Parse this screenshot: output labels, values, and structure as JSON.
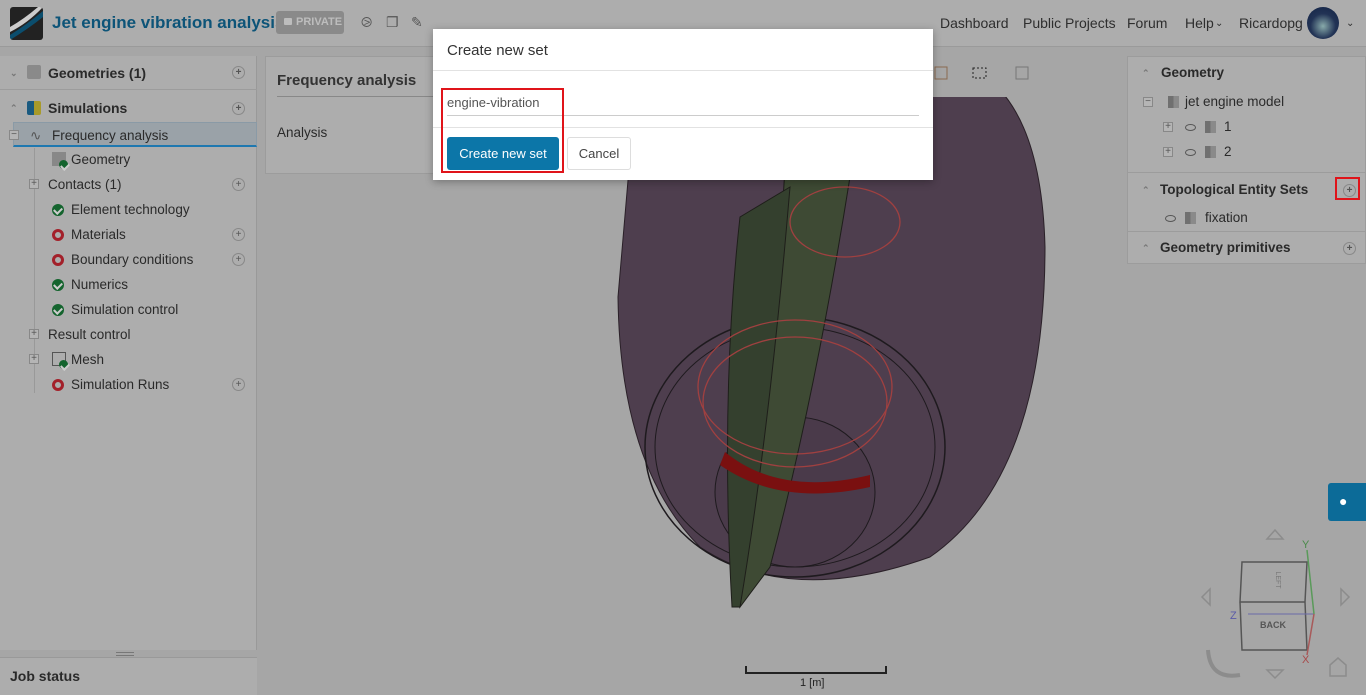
{
  "header": {
    "project_title": "Jet engine vibration analysis",
    "private_badge": "PRIVATE",
    "nav": [
      "Dashboard",
      "Public Projects",
      "Forum",
      "Help",
      "Ricardopg"
    ]
  },
  "left_tree": {
    "geometries": "Geometries (1)",
    "simulations": "Simulations",
    "simulation": "Frequency analysis",
    "items": [
      "Geometry",
      "Contacts (1)",
      "Element technology",
      "Materials",
      "Boundary conditions",
      "Numerics",
      "Simulation control",
      "Result control",
      "Mesh",
      "Simulation Runs"
    ]
  },
  "job_status": "Job status",
  "mid_panel": {
    "title": "Frequency analysis",
    "item": "Analysis"
  },
  "right_panel": {
    "geometry": "Geometry",
    "model": "jet engine model",
    "parts": [
      "1",
      "2"
    ],
    "topo_sets": "Topological Entity Sets",
    "sets": [
      "fixation"
    ],
    "primitives": "Geometry primitives"
  },
  "modal": {
    "title": "Create new set",
    "input_value": "engine-vibration",
    "create_label": "Create new set",
    "cancel_label": "Cancel"
  },
  "viewer": {
    "scale_label": "1 [m]",
    "cube_front": "BACK",
    "cube_top": "LEFT",
    "axes": [
      "X",
      "Y",
      "Z"
    ]
  }
}
